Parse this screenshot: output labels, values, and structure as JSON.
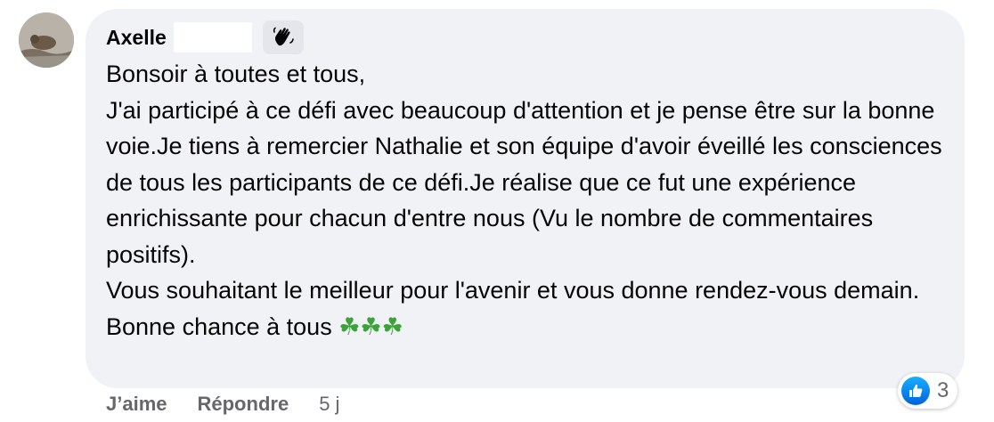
{
  "comment": {
    "author": "Axelle",
    "badge_icon": "waving-hand-icon",
    "lines": [
      "Bonsoir à toutes et tous,",
      "J'ai participé à ce défi avec beaucoup d'attention et je pense être sur la bonne voie.Je tiens à remercier Nathalie et son équipe d'avoir éveillé les consciences de tous les participants de ce défi.Je réalise que ce fut une expérience enrichissante pour chacun d'entre nous (Vu le nombre de commentaires positifs).",
      "Vous souhaitant le meilleur pour l'avenir et vous donne rendez-vous demain.",
      "Bonne chance à tous"
    ],
    "emoji": "☘☘☘",
    "emoji_icon": "shamrock-icon",
    "emoji_color": "#3aa33a"
  },
  "reactions": {
    "icon": "like-icon",
    "count": "3",
    "color": "#1877f2"
  },
  "actions": {
    "like": "J’aime",
    "reply": "Répondre",
    "time": "5 j"
  }
}
